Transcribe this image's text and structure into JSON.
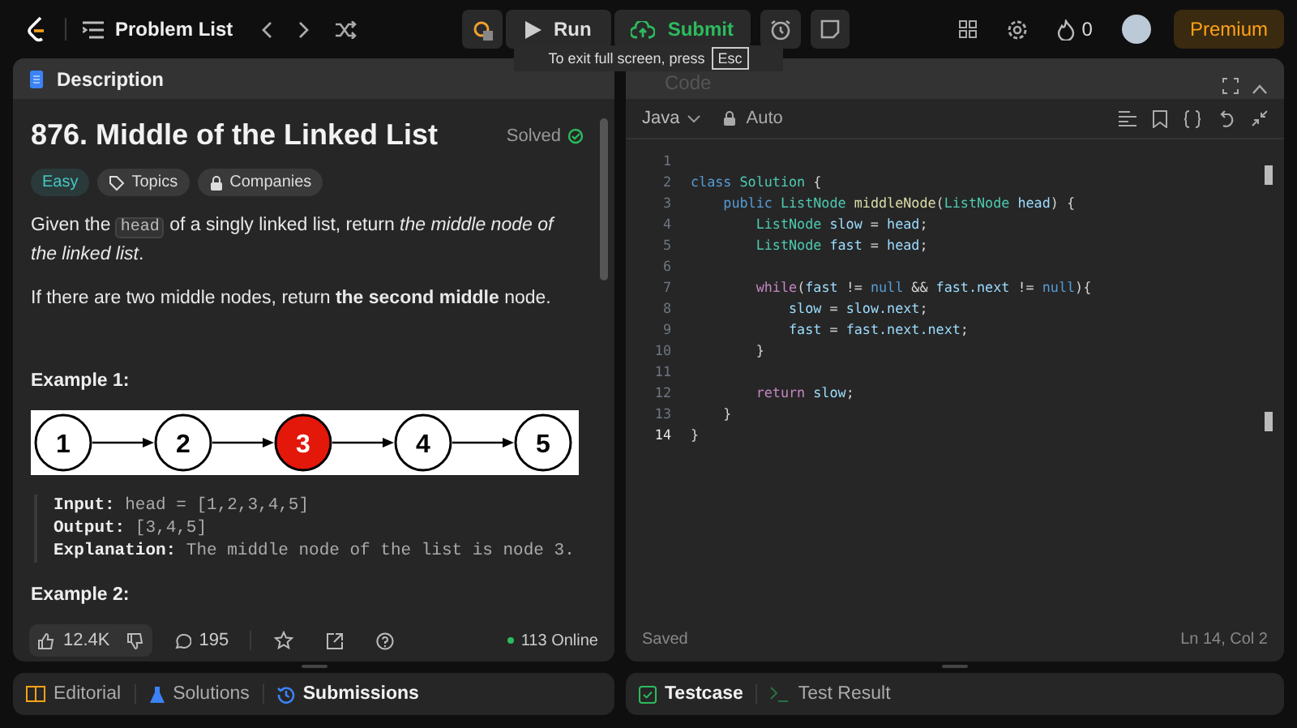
{
  "topbar": {
    "nav_label": "Problem List",
    "run": "Run",
    "submit": "Submit",
    "streak": "0",
    "premium": "Premium"
  },
  "tooltip": {
    "text": "To exit full screen, press",
    "key": "Esc"
  },
  "description": {
    "tab": "Description",
    "title": "876. Middle of the Linked List",
    "status": "Solved",
    "solved": true,
    "tags": [
      {
        "kind": "difficulty",
        "label": "Easy"
      },
      {
        "kind": "topics",
        "label": "Topics"
      },
      {
        "kind": "companies",
        "label": "Companies"
      }
    ],
    "para1": {
      "before": "Given the",
      "code": "head",
      "after": "of a singly linked list, return *the middle node of the linked list*."
    },
    "para2": "If there are two middle nodes, return **the second middle** node.",
    "example1": {
      "heading": "Example 1:",
      "nodes": [
        {
          "label": "1",
          "highlighted": false
        },
        {
          "label": "2",
          "highlighted": false
        },
        {
          "label": "3",
          "highlighted": true
        },
        {
          "label": "4",
          "highlighted": false
        },
        {
          "label": "5",
          "highlighted": false
        }
      ],
      "lines": [
        {
          "label": "Input:",
          "value": "head = [1,2,3,4,5]"
        },
        {
          "label": "Output:",
          "value": "[3,4,5]"
        },
        {
          "label": "Explanation:",
          "value": "The middle node of the list is node 3."
        }
      ]
    },
    "example2_heading": "Example 2:",
    "footer": {
      "likes": "12.4K",
      "comments": "195",
      "online": "113 Online"
    }
  },
  "left_tabs": [
    {
      "kind": "editorial",
      "label": "Editorial",
      "selected": false
    },
    {
      "kind": "solutions",
      "label": "Solutions",
      "selected": false
    },
    {
      "kind": "submissions",
      "label": "Submissions",
      "selected": true
    }
  ],
  "code": {
    "tab": "Code",
    "language": "Java",
    "mode": "Auto",
    "lines": [
      {
        "n": "1",
        "current": false
      },
      {
        "n": "2",
        "current": false,
        "tokens": [
          {
            "t": "class ",
            "color": "#569cd6"
          },
          {
            "t": "Solution",
            "color": "#4ec9b0"
          },
          {
            "t": " {",
            "color": "#d4d4d4"
          }
        ]
      },
      {
        "n": "3",
        "current": false,
        "tokens": [
          {
            "t": "    public ",
            "color": "#569cd6"
          },
          {
            "t": "ListNode ",
            "color": "#4ec9b0"
          },
          {
            "t": "middleNode",
            "color": "#dcdcaa"
          },
          {
            "t": "(",
            "color": "#d4d4d4"
          },
          {
            "t": "ListNode ",
            "color": "#4ec9b0"
          },
          {
            "t": "head",
            "color": "#9cdcfe"
          },
          {
            "t": ") {",
            "color": "#d4d4d4"
          }
        ]
      },
      {
        "n": "4",
        "current": false,
        "tokens": [
          {
            "t": "        ListNode ",
            "color": "#4ec9b0"
          },
          {
            "t": "slow",
            "color": "#9cdcfe"
          },
          {
            "t": " = ",
            "color": "#d4d4d4"
          },
          {
            "t": "head",
            "color": "#9cdcfe"
          },
          {
            "t": ";",
            "color": "#d4d4d4"
          }
        ]
      },
      {
        "n": "5",
        "current": false,
        "tokens": [
          {
            "t": "        ListNode ",
            "color": "#4ec9b0"
          },
          {
            "t": "fast",
            "color": "#9cdcfe"
          },
          {
            "t": " = ",
            "color": "#d4d4d4"
          },
          {
            "t": "head",
            "color": "#9cdcfe"
          },
          {
            "t": ";",
            "color": "#d4d4d4"
          }
        ]
      },
      {
        "n": "6",
        "current": false
      },
      {
        "n": "7",
        "current": false,
        "tokens": [
          {
            "t": "        while",
            "color": "#c586c0"
          },
          {
            "t": "(",
            "color": "#d4d4d4"
          },
          {
            "t": "fast",
            "color": "#9cdcfe"
          },
          {
            "t": " != ",
            "color": "#d4d4d4"
          },
          {
            "t": "null",
            "color": "#569cd6"
          },
          {
            "t": " && ",
            "color": "#d4d4d4"
          },
          {
            "t": "fast.next",
            "color": "#9cdcfe"
          },
          {
            "t": " != ",
            "color": "#d4d4d4"
          },
          {
            "t": "null",
            "color": "#569cd6"
          },
          {
            "t": "){",
            "color": "#d4d4d4"
          }
        ]
      },
      {
        "n": "8",
        "current": false,
        "tokens": [
          {
            "t": "            slow",
            "color": "#9cdcfe"
          },
          {
            "t": " = ",
            "color": "#d4d4d4"
          },
          {
            "t": "slow.next",
            "color": "#9cdcfe"
          },
          {
            "t": ";",
            "color": "#d4d4d4"
          }
        ]
      },
      {
        "n": "9",
        "current": false,
        "tokens": [
          {
            "t": "            fast",
            "color": "#9cdcfe"
          },
          {
            "t": " = ",
            "color": "#d4d4d4"
          },
          {
            "t": "fast.next.next",
            "color": "#9cdcfe"
          },
          {
            "t": ";",
            "color": "#d4d4d4"
          }
        ]
      },
      {
        "n": "10",
        "current": false,
        "tokens": [
          {
            "t": "        }",
            "color": "#d4d4d4"
          }
        ]
      },
      {
        "n": "11",
        "current": false
      },
      {
        "n": "12",
        "current": false,
        "tokens": [
          {
            "t": "        return ",
            "color": "#c586c0"
          },
          {
            "t": "slow",
            "color": "#9cdcfe"
          },
          {
            "t": ";",
            "color": "#d4d4d4"
          }
        ]
      },
      {
        "n": "13",
        "current": false,
        "tokens": [
          {
            "t": "    }",
            "color": "#d4d4d4"
          }
        ]
      },
      {
        "n": "14",
        "current": true,
        "tokens": [
          {
            "t": "}",
            "color": "#d4d4d4"
          }
        ]
      }
    ],
    "status": "Saved",
    "cursor": "Ln 14, Col 2"
  },
  "right_tabs": [
    {
      "kind": "testcase",
      "label": "Testcase",
      "selected": true
    },
    {
      "kind": "result",
      "label": "Test Result",
      "selected": false
    }
  ]
}
